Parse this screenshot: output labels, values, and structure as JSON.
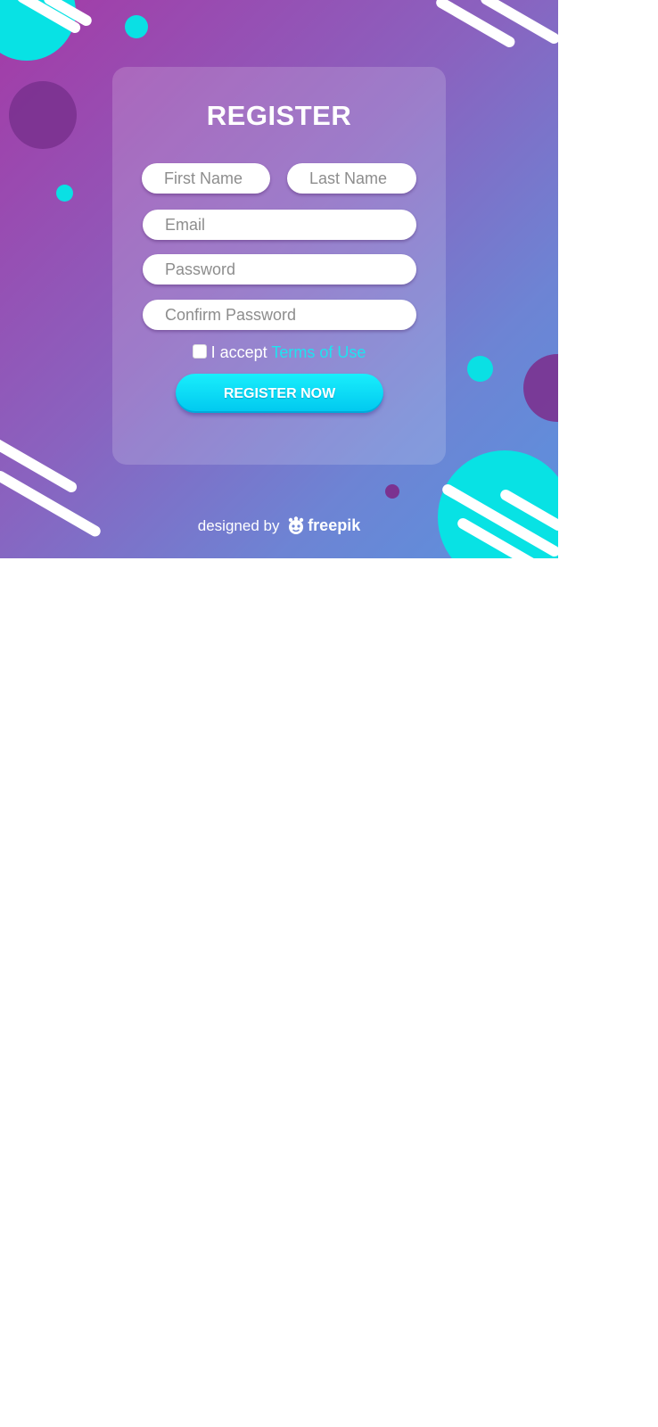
{
  "form": {
    "title": "REGISTER",
    "fields": {
      "first_name": {
        "placeholder": "First Name",
        "value": ""
      },
      "last_name": {
        "placeholder": "Last Name",
        "value": ""
      },
      "email": {
        "placeholder": "Email",
        "value": ""
      },
      "password": {
        "placeholder": "Password",
        "value": ""
      },
      "confirm_password": {
        "placeholder": "Confirm Password",
        "value": ""
      }
    },
    "terms": {
      "prefix": "I accept",
      "link_text": "Terms of Use",
      "checked": false
    },
    "submit_label": "REGISTER NOW"
  },
  "footer": {
    "prefix": "designed by",
    "brand": "freepik"
  },
  "colors": {
    "accent": "#00e5f5",
    "gradient_start": "#a43aa6",
    "gradient_end": "#5a92de",
    "decor_purple": "#7b3290",
    "link": "#1ee3f0"
  },
  "icons": {
    "brand_logo": "freepik-logo-icon",
    "checkbox": "checkbox-icon"
  }
}
